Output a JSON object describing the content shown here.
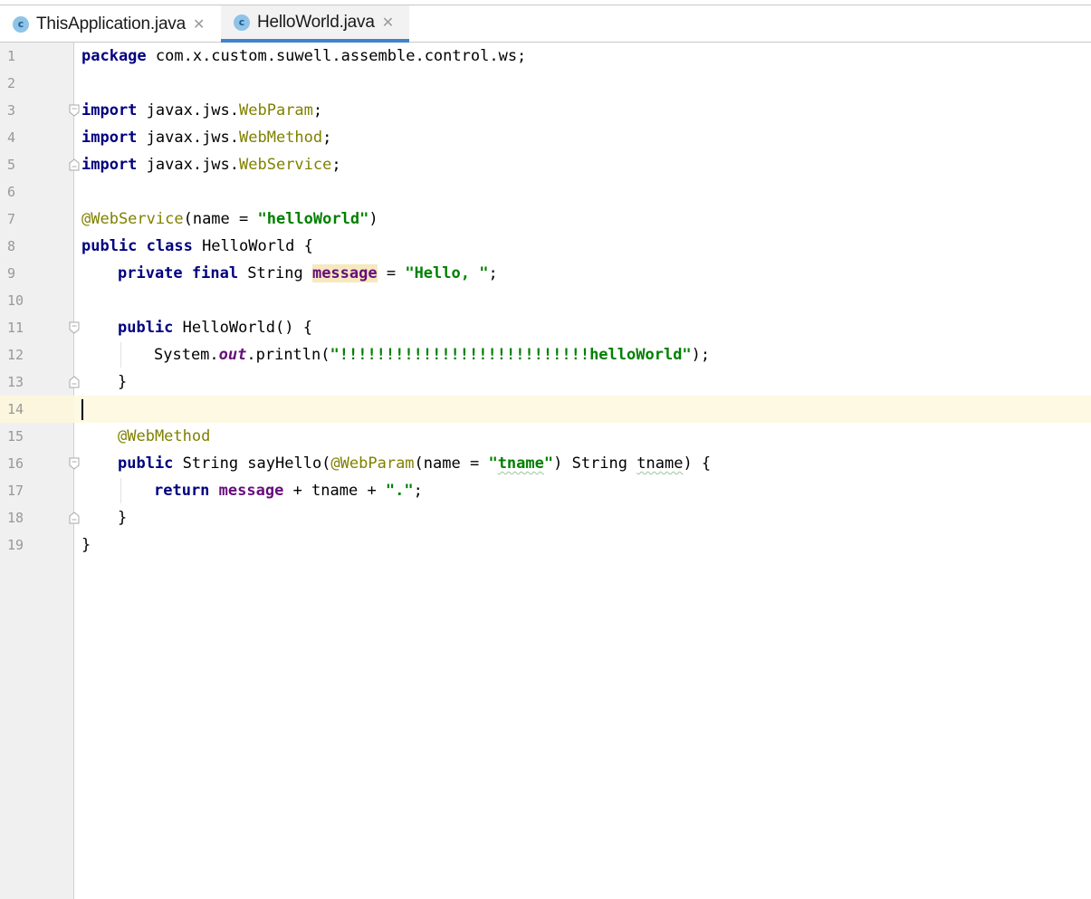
{
  "tabs": [
    {
      "label": "ThisApplication.java",
      "icon": "class-icon",
      "icon_letter": "c",
      "active": false
    },
    {
      "label": "HelloWorld.java",
      "icon": "class-icon",
      "icon_letter": "c",
      "active": true
    }
  ],
  "editor": {
    "current_line": 14,
    "line_numbers": [
      "1",
      "2",
      "3",
      "4",
      "5",
      "6",
      "7",
      "8",
      "9",
      "10",
      "11",
      "12",
      "13",
      "14",
      "15",
      "16",
      "17",
      "18",
      "19"
    ],
    "code": {
      "l1": {
        "kw": "package",
        "rest": " com.x.custom.suwell.assemble.control.ws;"
      },
      "l3": {
        "kw": "import",
        "pkg": " javax.jws.",
        "cls": "WebParam",
        "end": ";"
      },
      "l4": {
        "kw": "import",
        "pkg": " javax.jws.",
        "cls": "WebMethod",
        "end": ";"
      },
      "l5": {
        "kw": "import",
        "pkg": " javax.jws.",
        "cls": "WebService",
        "end": ";"
      },
      "l7": {
        "ann": "@WebService",
        "mid": "(name = ",
        "str": "\"helloWorld\"",
        "end": ")"
      },
      "l8": {
        "kw": "public class",
        "rest": " HelloWorld {"
      },
      "l9": {
        "kw": "private final",
        "type": " String ",
        "field": "message",
        "mid": " = ",
        "str": "\"Hello, \"",
        "end": ";"
      },
      "l11": {
        "kw": "public",
        "rest": " HelloWorld() {"
      },
      "l12": {
        "pre": "System.",
        "static": "out",
        "mid": ".println(",
        "str": "\"!!!!!!!!!!!!!!!!!!!!!!!!!!!helloWorld\"",
        "end": ");"
      },
      "l13": {
        "text": "}"
      },
      "l15": {
        "ann": "@WebMethod"
      },
      "l16": {
        "kw": "public",
        "type": " String sayHello(",
        "ann": "@WebParam",
        "mid": "(name = ",
        "str_q1": "\"",
        "str_in": "tname",
        "str_q2": "\"",
        "mid2": ") String ",
        "param": "tname",
        "end": ") {"
      },
      "l17": {
        "kw": "return",
        "sp": " ",
        "field": "message",
        "mid": " + tname + ",
        "str": "\".\"",
        "end": ";"
      },
      "l18": {
        "text": "}"
      },
      "l19": {
        "text": "}"
      }
    }
  },
  "colors": {
    "keyword": "#000080",
    "string": "#008000",
    "annotation": "#808000",
    "field": "#660e7a",
    "active_tab_underline": "#4083c9",
    "current_line": "#fdf9e3"
  }
}
